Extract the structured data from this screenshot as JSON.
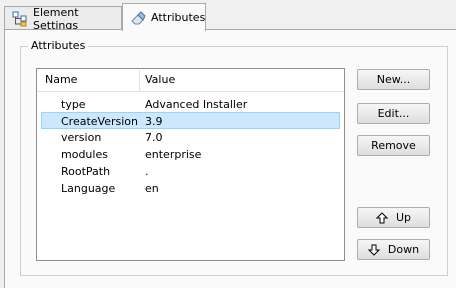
{
  "tabs": [
    {
      "label": "Element Settings",
      "icon": "element-settings-icon",
      "active": false
    },
    {
      "label": "Attributes",
      "icon": "eraser-icon",
      "active": true
    }
  ],
  "group": {
    "title": "Attributes"
  },
  "list": {
    "columns": {
      "name": "Name",
      "value": "Value"
    },
    "rows": [
      {
        "name": "type",
        "value": "Advanced Installer"
      },
      {
        "name": "CreateVersion",
        "value": "3.9",
        "selected": true
      },
      {
        "name": "version",
        "value": "7.0"
      },
      {
        "name": "modules",
        "value": "enterprise"
      },
      {
        "name": "RootPath",
        "value": "."
      },
      {
        "name": "Language",
        "value": "en"
      }
    ]
  },
  "buttons": {
    "new": "New...",
    "edit": "Edit...",
    "remove": "Remove",
    "up": "Up",
    "down": "Down"
  },
  "colors": {
    "selection": "#cce8ff",
    "selection_border": "#99d1ff"
  }
}
